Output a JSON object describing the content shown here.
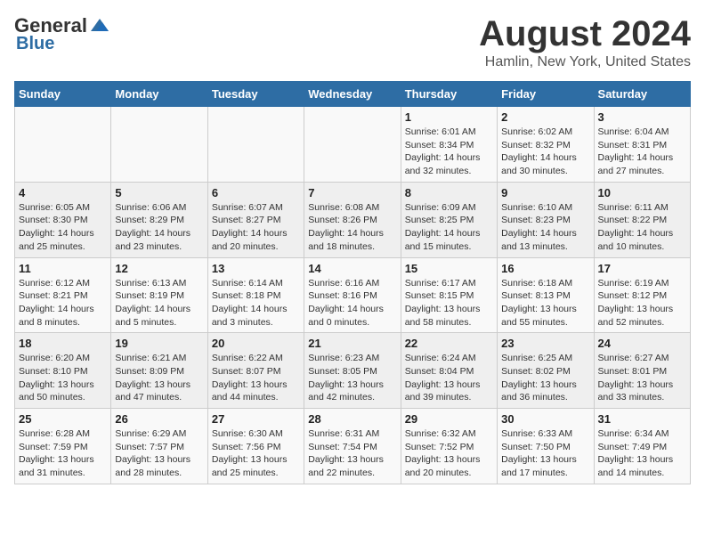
{
  "header": {
    "logo_general": "General",
    "logo_blue": "Blue",
    "title": "August 2024",
    "subtitle": "Hamlin, New York, United States"
  },
  "weekdays": [
    "Sunday",
    "Monday",
    "Tuesday",
    "Wednesday",
    "Thursday",
    "Friday",
    "Saturday"
  ],
  "weeks": [
    [
      {
        "day": "",
        "info": ""
      },
      {
        "day": "",
        "info": ""
      },
      {
        "day": "",
        "info": ""
      },
      {
        "day": "",
        "info": ""
      },
      {
        "day": "1",
        "info": "Sunrise: 6:01 AM\nSunset: 8:34 PM\nDaylight: 14 hours\nand 32 minutes."
      },
      {
        "day": "2",
        "info": "Sunrise: 6:02 AM\nSunset: 8:32 PM\nDaylight: 14 hours\nand 30 minutes."
      },
      {
        "day": "3",
        "info": "Sunrise: 6:04 AM\nSunset: 8:31 PM\nDaylight: 14 hours\nand 27 minutes."
      }
    ],
    [
      {
        "day": "4",
        "info": "Sunrise: 6:05 AM\nSunset: 8:30 PM\nDaylight: 14 hours\nand 25 minutes."
      },
      {
        "day": "5",
        "info": "Sunrise: 6:06 AM\nSunset: 8:29 PM\nDaylight: 14 hours\nand 23 minutes."
      },
      {
        "day": "6",
        "info": "Sunrise: 6:07 AM\nSunset: 8:27 PM\nDaylight: 14 hours\nand 20 minutes."
      },
      {
        "day": "7",
        "info": "Sunrise: 6:08 AM\nSunset: 8:26 PM\nDaylight: 14 hours\nand 18 minutes."
      },
      {
        "day": "8",
        "info": "Sunrise: 6:09 AM\nSunset: 8:25 PM\nDaylight: 14 hours\nand 15 minutes."
      },
      {
        "day": "9",
        "info": "Sunrise: 6:10 AM\nSunset: 8:23 PM\nDaylight: 14 hours\nand 13 minutes."
      },
      {
        "day": "10",
        "info": "Sunrise: 6:11 AM\nSunset: 8:22 PM\nDaylight: 14 hours\nand 10 minutes."
      }
    ],
    [
      {
        "day": "11",
        "info": "Sunrise: 6:12 AM\nSunset: 8:21 PM\nDaylight: 14 hours\nand 8 minutes."
      },
      {
        "day": "12",
        "info": "Sunrise: 6:13 AM\nSunset: 8:19 PM\nDaylight: 14 hours\nand 5 minutes."
      },
      {
        "day": "13",
        "info": "Sunrise: 6:14 AM\nSunset: 8:18 PM\nDaylight: 14 hours\nand 3 minutes."
      },
      {
        "day": "14",
        "info": "Sunrise: 6:16 AM\nSunset: 8:16 PM\nDaylight: 14 hours\nand 0 minutes."
      },
      {
        "day": "15",
        "info": "Sunrise: 6:17 AM\nSunset: 8:15 PM\nDaylight: 13 hours\nand 58 minutes."
      },
      {
        "day": "16",
        "info": "Sunrise: 6:18 AM\nSunset: 8:13 PM\nDaylight: 13 hours\nand 55 minutes."
      },
      {
        "day": "17",
        "info": "Sunrise: 6:19 AM\nSunset: 8:12 PM\nDaylight: 13 hours\nand 52 minutes."
      }
    ],
    [
      {
        "day": "18",
        "info": "Sunrise: 6:20 AM\nSunset: 8:10 PM\nDaylight: 13 hours\nand 50 minutes."
      },
      {
        "day": "19",
        "info": "Sunrise: 6:21 AM\nSunset: 8:09 PM\nDaylight: 13 hours\nand 47 minutes."
      },
      {
        "day": "20",
        "info": "Sunrise: 6:22 AM\nSunset: 8:07 PM\nDaylight: 13 hours\nand 44 minutes."
      },
      {
        "day": "21",
        "info": "Sunrise: 6:23 AM\nSunset: 8:05 PM\nDaylight: 13 hours\nand 42 minutes."
      },
      {
        "day": "22",
        "info": "Sunrise: 6:24 AM\nSunset: 8:04 PM\nDaylight: 13 hours\nand 39 minutes."
      },
      {
        "day": "23",
        "info": "Sunrise: 6:25 AM\nSunset: 8:02 PM\nDaylight: 13 hours\nand 36 minutes."
      },
      {
        "day": "24",
        "info": "Sunrise: 6:27 AM\nSunset: 8:01 PM\nDaylight: 13 hours\nand 33 minutes."
      }
    ],
    [
      {
        "day": "25",
        "info": "Sunrise: 6:28 AM\nSunset: 7:59 PM\nDaylight: 13 hours\nand 31 minutes."
      },
      {
        "day": "26",
        "info": "Sunrise: 6:29 AM\nSunset: 7:57 PM\nDaylight: 13 hours\nand 28 minutes."
      },
      {
        "day": "27",
        "info": "Sunrise: 6:30 AM\nSunset: 7:56 PM\nDaylight: 13 hours\nand 25 minutes."
      },
      {
        "day": "28",
        "info": "Sunrise: 6:31 AM\nSunset: 7:54 PM\nDaylight: 13 hours\nand 22 minutes."
      },
      {
        "day": "29",
        "info": "Sunrise: 6:32 AM\nSunset: 7:52 PM\nDaylight: 13 hours\nand 20 minutes."
      },
      {
        "day": "30",
        "info": "Sunrise: 6:33 AM\nSunset: 7:50 PM\nDaylight: 13 hours\nand 17 minutes."
      },
      {
        "day": "31",
        "info": "Sunrise: 6:34 AM\nSunset: 7:49 PM\nDaylight: 13 hours\nand 14 minutes."
      }
    ]
  ]
}
